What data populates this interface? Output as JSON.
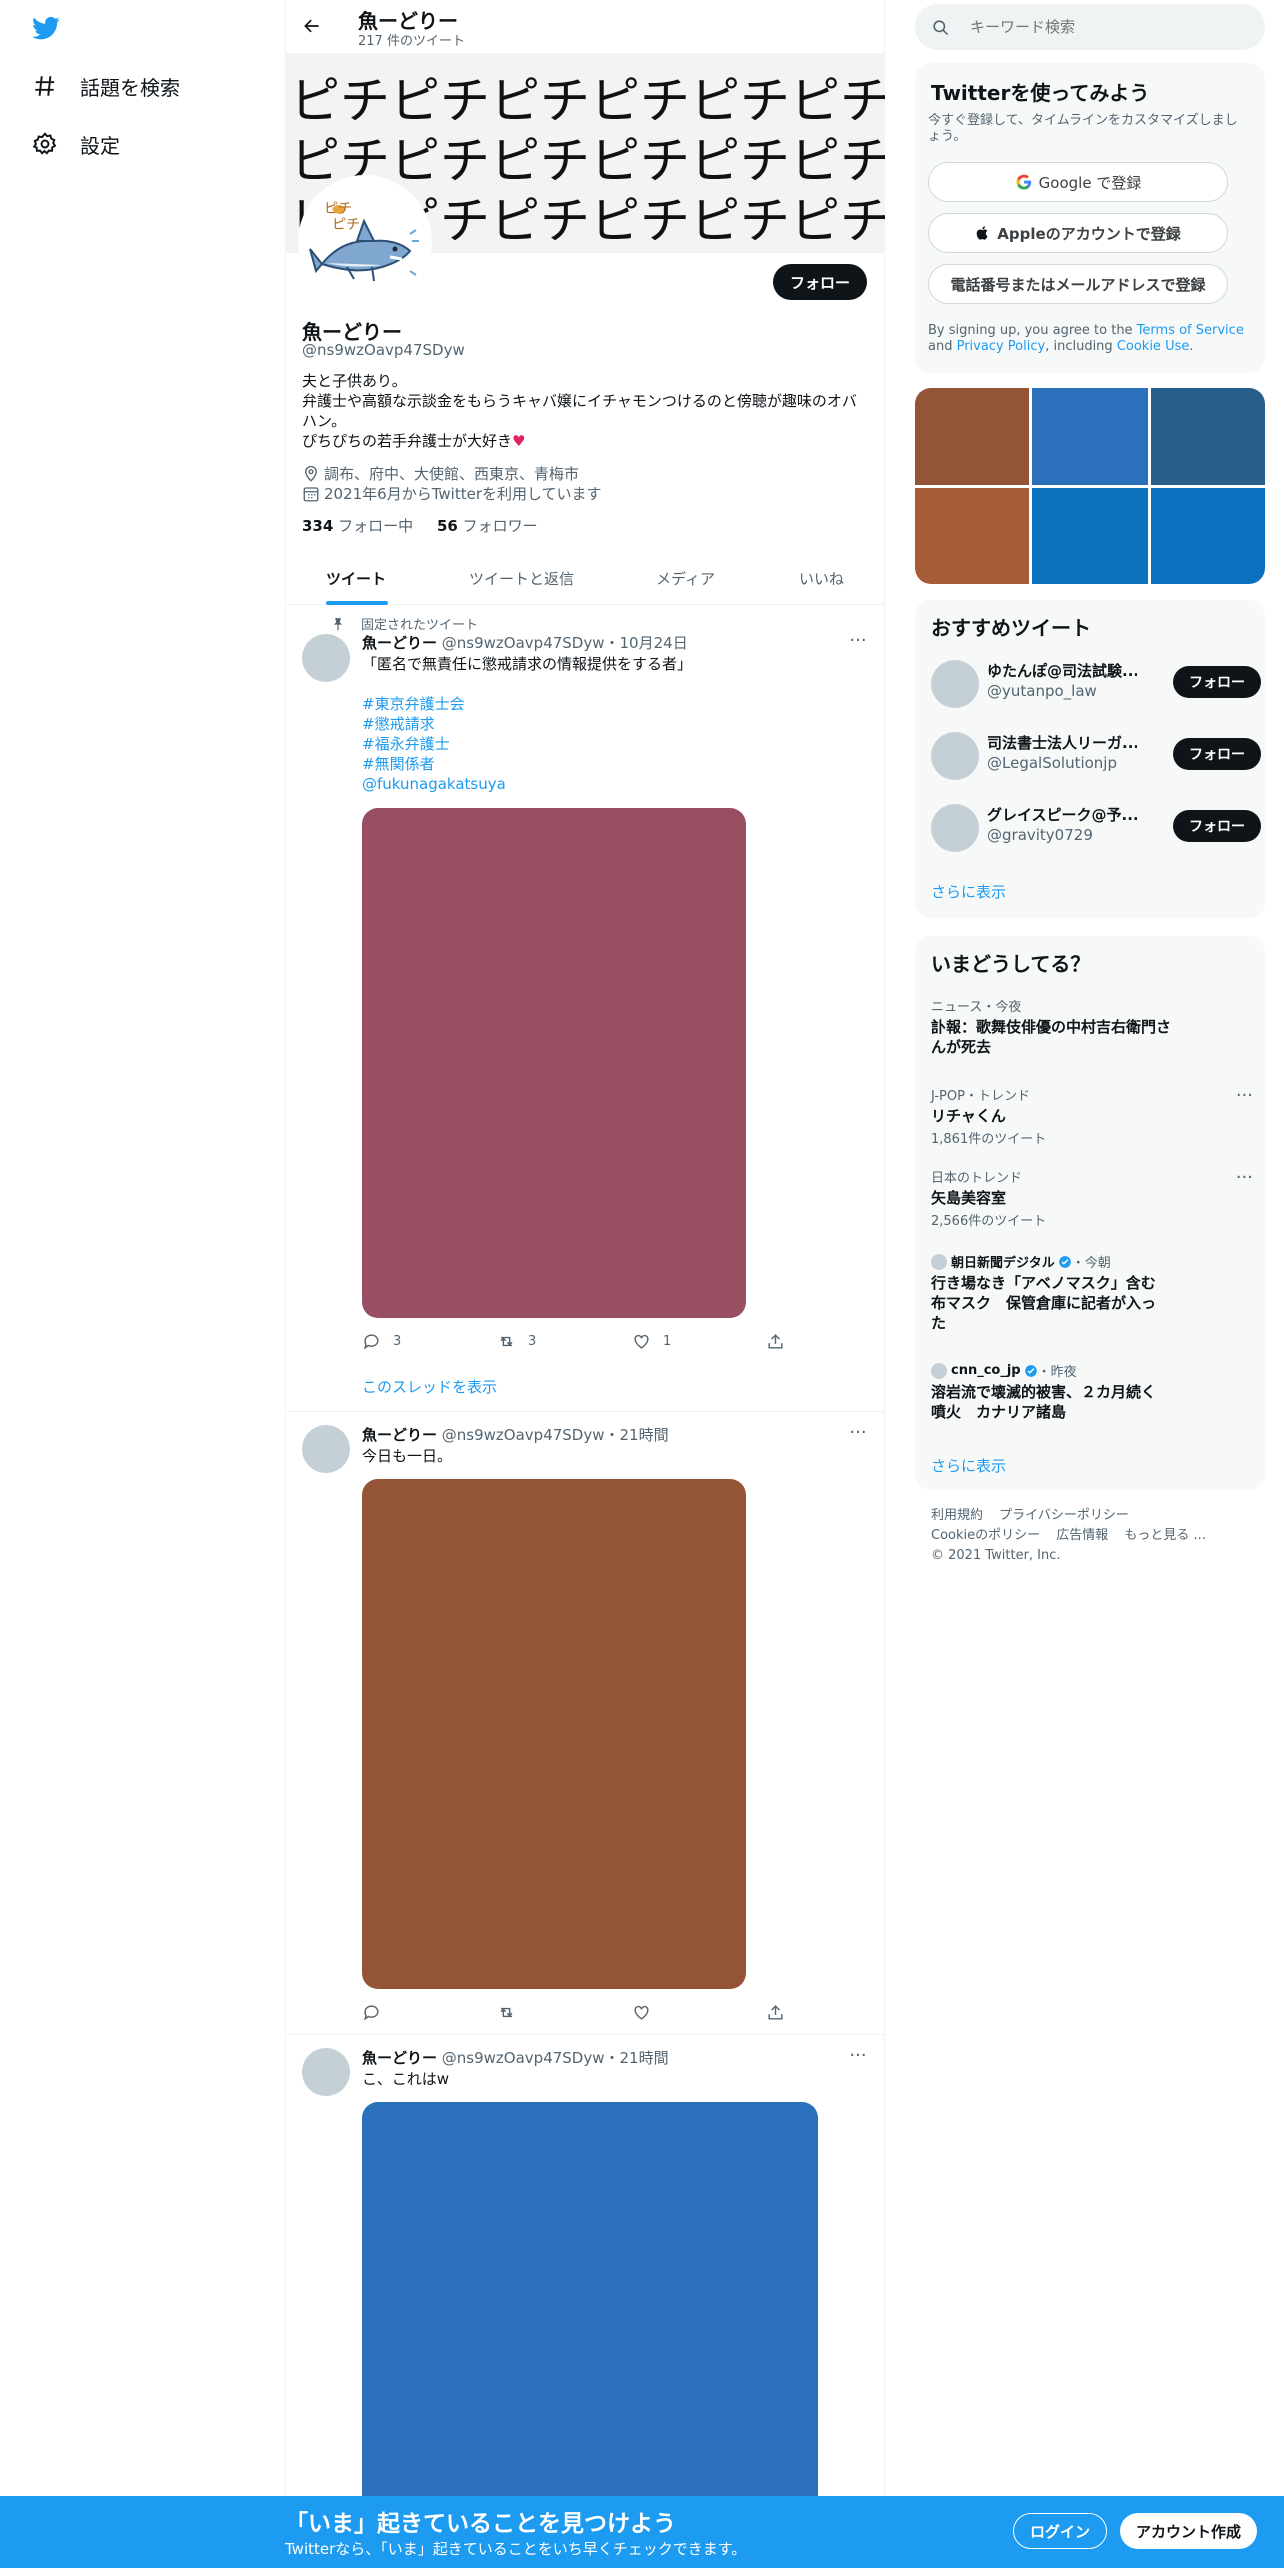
{
  "nav": {
    "explore_label": "話題を検索",
    "settings_label": "設定"
  },
  "header": {
    "name": "魚ーどりー",
    "tweet_count": "217 件のツイート"
  },
  "banner": {
    "rows": [
      "ピチピチピチピチピチピチピチピチピ",
      "ピチピチピチピチピチピチピチピチピ",
      "ピチピチピチピチピチピチピチピチピ"
    ]
  },
  "profile": {
    "follow_label": "フォロー",
    "name": "魚ーどりー",
    "handle": "@ns9wzOavp47SDyw",
    "bio_lines": [
      "夫と子供あり。",
      "弁護士や高額な示談金をもらうキャバ嬢にイチャモンつけるのと傍聴が趣味のオバ",
      "ハン。",
      "ぴちぴちの若手弁護士が大好き♥"
    ],
    "location": "調布、府中、大使館、西東京、青梅市",
    "joined": "2021年6月からTwitterを利用しています",
    "following_count": "334",
    "following_label": "フォロー中",
    "followers_count": "56",
    "followers_label": "フォロワー"
  },
  "tabs": [
    "ツイート",
    "ツイートと返信",
    "メディア",
    "いいね"
  ],
  "tweets": [
    {
      "pinned_label": "固定されたツイート",
      "name": "魚ーどりー",
      "handle": "@ns9wzOavp47SDyw",
      "time": "・10月24日",
      "text": "「匿名で無責任に懲戒請求の情報提供をする者」",
      "tags": [
        "#東京弁護士会",
        "#懲戒請求",
        "#福永弁護士",
        "#無関係者",
        "@fukunagakatsuya"
      ],
      "media_color": "#984f62",
      "reply_count": "3",
      "retweet_count": "3",
      "like_count": "1",
      "thread_link": "このスレッドを表示"
    },
    {
      "name": "魚ーどりー",
      "handle": "@ns9wzOavp47SDyw",
      "time": "・21時間",
      "text": "今日も一日。",
      "media_color": "#935535"
    },
    {
      "name": "魚ーどりー",
      "handle": "@ns9wzOavp47SDyw",
      "time": "・21時間",
      "text": "こ、これはw",
      "media_color": "#2a70bb"
    }
  ],
  "search": {
    "placeholder": "キーワード検索"
  },
  "signup": {
    "title": "Twitterを使ってみよう",
    "subtitle": "今すぐ登録して、タイムラインをカスタマイズしましょう。",
    "google_label": "Google で登録",
    "apple_label": "Appleのアカウントで登録",
    "phone_label": "電話番号またはメールアドレスで登録",
    "terms_prefix": "By signing up, you agree to the ",
    "terms_link": "Terms of Service",
    "terms_and": " and ",
    "privacy_link": "Privacy Policy",
    "terms_including": ", including ",
    "cookie_link": "Cookie Use",
    "terms_end": "."
  },
  "media_grid": {
    "colors": [
      "#935535",
      "#2a70bb",
      "#285f8a",
      "#a65c36",
      "#0b72bd",
      "#0a70c0"
    ]
  },
  "recommended": {
    "title": "おすすめツイート",
    "items": [
      {
        "name": "ゆたんぽ@司法試験...",
        "handle": "@yutanpo_law",
        "button": "フォロー"
      },
      {
        "name": "司法書士法人リーガ...",
        "handle": "@LegalSolutionjp",
        "button": "フォロー"
      },
      {
        "name": "グレイスピーク@予...",
        "handle": "@gravity0729",
        "button": "フォロー"
      }
    ],
    "show_more": "さらに表示"
  },
  "trends": {
    "title": "いまどうしてる？",
    "items": [
      {
        "context": "ニュース・今夜",
        "title": "訃報：歌舞伎俳優の中村吉右衛門さんが死去"
      },
      {
        "context": "J-POP・トレンド",
        "title": "リチャくん",
        "count": "1,861件のツイート"
      },
      {
        "context": "日本のトレンド",
        "title": "矢島美容室",
        "count": "2,566件のツイート"
      },
      {
        "source": "朝日新聞デジタル",
        "time": "・今朝",
        "title": "行き場なき「アベノマスク」含む布マスク　保管倉庫に記者が入った"
      },
      {
        "source": "cnn_co_jp",
        "time": "・昨夜",
        "title": "溶岩流で壊滅的被害、２カ月続く噴火　カナリア諸島"
      }
    ],
    "show_more": "さらに表示"
  },
  "footer": {
    "links": [
      "利用規約",
      "プライバシーポリシー",
      "Cookieのポリシー",
      "広告情報",
      "もっと見る ..."
    ],
    "copyright": "© 2021 Twitter, Inc."
  },
  "bottombar": {
    "headline": "「いま」起きていることを見つけよう",
    "sub": "Twitterなら、「いま」起きていることをいち早くチェックできます。",
    "login_label": "ログイン",
    "signup_label": "アカウント作成"
  },
  "colors": {
    "accent": "#1d9bf0",
    "dark": "#0f1419"
  }
}
